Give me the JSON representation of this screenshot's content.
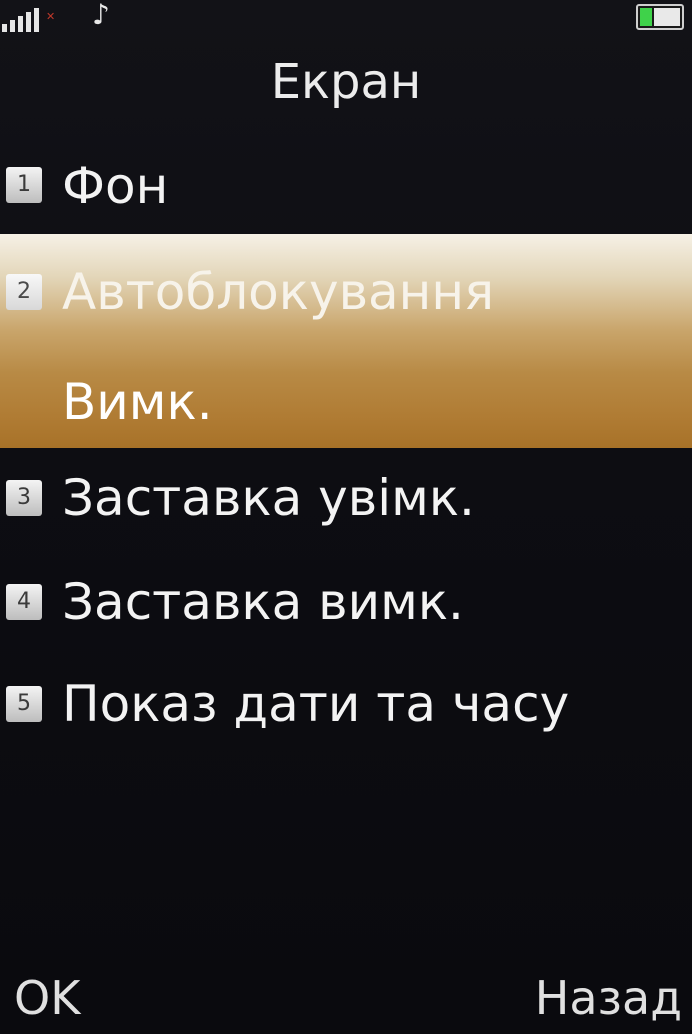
{
  "screen": {
    "title": "Екран"
  },
  "status_bar": {
    "signal_icon": "signal-bars-icon",
    "music_icon": "music-note-icon",
    "battery_icon": "battery-icon"
  },
  "menu": {
    "items": [
      {
        "number": "1",
        "label": "Фон"
      },
      {
        "number": "2",
        "label": "Автоблокування",
        "value": "Вимк.",
        "selected": true
      },
      {
        "number": "3",
        "label": "Заставка увімк."
      },
      {
        "number": "4",
        "label": "Заставка вимк."
      },
      {
        "number": "5",
        "label": "Показ дати та часу"
      }
    ]
  },
  "softkeys": {
    "left": "OK",
    "right": "Назад"
  },
  "colors": {
    "highlight": "#c9a56b",
    "background": "#0c0c11",
    "text": "#f2f2f2"
  }
}
